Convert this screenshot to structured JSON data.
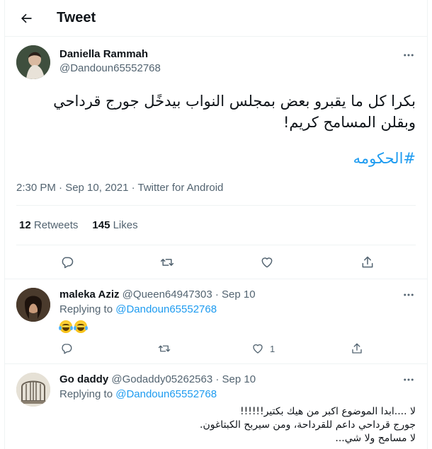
{
  "header": {
    "title": "Tweet"
  },
  "tweet": {
    "author_name": "Daniella Rammah",
    "author_handle": "@Dandoun65552768",
    "text_line1": "بكرا كل ما يقبرو بعض بمجلس النواب بيدخًل جورج قرداحي",
    "text_line2": "وبقلن المسامح كريم!",
    "hashtag": "#الحكومه",
    "meta": "2:30 PM · Sep 10, 2021 · Twitter for Android",
    "retweets_count": "12",
    "retweets_label": "Retweets",
    "likes_count": "145",
    "likes_label": "Likes"
  },
  "replies": [
    {
      "name": "maleka Aziz",
      "handle": "@Queen64947303",
      "date": "· Sep 10",
      "replying_prefix": "Replying to",
      "replying_to": "@Dandoun65552768",
      "content": "😂😂",
      "like_count": "1"
    },
    {
      "name": "Go daddy",
      "handle": "@Godaddy05262563",
      "date": "· Sep 10",
      "replying_prefix": "Replying to",
      "replying_to": "@Dandoun65552768",
      "lines": [
        "لا ....ابدا الموضوع اكبر من هيك بكتير!!!!!!",
        "جورج قرداحي داعم للقرداحة، ومن سيربح الكبتاغون.",
        "لا مسامح ولا شي..."
      ]
    }
  ],
  "icons": {
    "back": "arrow-left-icon",
    "more": "more-horizontal-icon",
    "reply": "reply-icon",
    "retweet": "retweet-icon",
    "like": "heart-icon",
    "share": "share-icon"
  },
  "colors": {
    "accent": "#1d9bf0",
    "secondary_text": "#536471",
    "border": "#eff3f4"
  }
}
